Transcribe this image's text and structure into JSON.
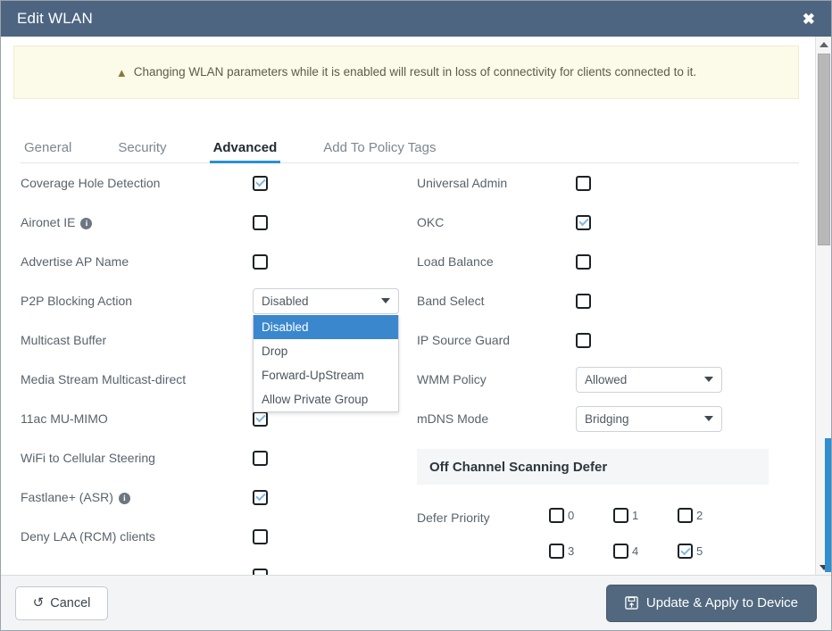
{
  "window": {
    "title": "Edit WLAN",
    "close_icon": "close-icon"
  },
  "warning": {
    "icon": "warning-triangle-icon",
    "text": "Changing WLAN parameters while it is enabled will result in loss of connectivity for clients connected to it."
  },
  "tabs": [
    {
      "label": "General",
      "active": false
    },
    {
      "label": "Security",
      "active": false
    },
    {
      "label": "Advanced",
      "active": true
    },
    {
      "label": "Add To Policy Tags",
      "active": false
    }
  ],
  "left_column": {
    "rows": [
      {
        "label": "Coverage Hole Detection",
        "control": "checkbox",
        "checked": true,
        "info": false
      },
      {
        "label": "Aironet IE",
        "control": "checkbox",
        "checked": false,
        "info": true
      },
      {
        "label": "Advertise AP Name",
        "control": "checkbox",
        "checked": false,
        "info": false
      },
      {
        "label": "P2P Blocking Action",
        "control": "select",
        "value": "Disabled",
        "open": true,
        "info": false
      },
      {
        "label": "Multicast Buffer",
        "control": "hidden",
        "checked": false,
        "info": false
      },
      {
        "label": "Media Stream Multicast-direct",
        "control": "hidden",
        "checked": false,
        "info": false
      },
      {
        "label": "11ac MU-MIMO",
        "control": "checkbox",
        "checked": true,
        "info": false
      },
      {
        "label": "WiFi to Cellular Steering",
        "control": "checkbox",
        "checked": false,
        "info": false
      },
      {
        "label": "Fastlane+ (ASR)",
        "control": "checkbox",
        "checked": true,
        "info": true
      },
      {
        "label": "Deny LAA (RCM) clients",
        "control": "checkbox",
        "checked": false,
        "info": false
      }
    ]
  },
  "p2p_dropdown": {
    "selected": "Disabled",
    "options": [
      "Disabled",
      "Drop",
      "Forward-UpStream",
      "Allow Private Group"
    ]
  },
  "right_column": {
    "rows": [
      {
        "label": "Universal Admin",
        "control": "checkbox",
        "checked": false
      },
      {
        "label": "OKC",
        "control": "checkbox",
        "checked": true
      },
      {
        "label": "Load Balance",
        "control": "checkbox",
        "checked": false
      },
      {
        "label": "Band Select",
        "control": "checkbox",
        "checked": false
      },
      {
        "label": "IP Source Guard",
        "control": "checkbox",
        "checked": false
      },
      {
        "label": "WMM Policy",
        "control": "select",
        "value": "Allowed"
      },
      {
        "label": "mDNS Mode",
        "control": "select",
        "value": "Bridging"
      }
    ]
  },
  "off_channel": {
    "section_title": "Off Channel Scanning Defer",
    "defer_label": "Defer Priority",
    "priorities": [
      {
        "num": "0",
        "checked": false
      },
      {
        "num": "1",
        "checked": false
      },
      {
        "num": "2",
        "checked": false
      },
      {
        "num": "3",
        "checked": false
      },
      {
        "num": "4",
        "checked": false
      },
      {
        "num": "5",
        "checked": true
      }
    ]
  },
  "footer": {
    "cancel_label": "Cancel",
    "cancel_icon": "undo-arrow-icon",
    "apply_label": "Update & Apply to Device",
    "apply_icon": "save-disk-icon"
  },
  "colors": {
    "titlebar": "#4d6580",
    "accent_tab": "#2a91d1",
    "dropdown_highlight": "#3a87cd",
    "warning_bg": "#fcfae8",
    "apply_button": "#51687f",
    "outer_scroll_thumb": "#2f8fd0"
  }
}
